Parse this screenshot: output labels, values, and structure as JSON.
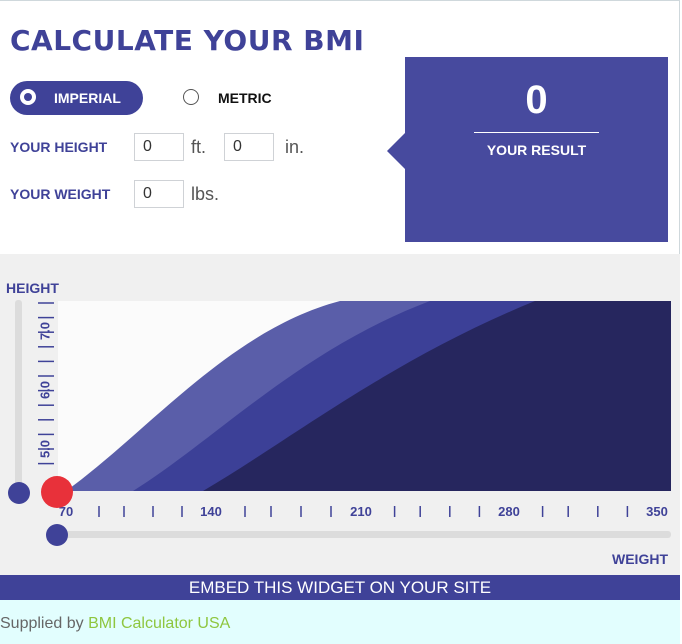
{
  "title": "CALCULATE YOUR BMI",
  "units": {
    "imperial_label": "IMPERIAL",
    "metric_label": "METRIC",
    "selected": "IMPERIAL"
  },
  "height": {
    "label": "YOUR HEIGHT",
    "ft_value": "0",
    "ft_unit": "ft.",
    "in_value": "0",
    "in_unit": "in."
  },
  "weight": {
    "label": "YOUR WEIGHT",
    "value": "0",
    "unit": "lbs."
  },
  "result": {
    "value": "0",
    "label": "YOUR RESULT"
  },
  "chart": {
    "height_axis_label": "HEIGHT",
    "weight_axis_label": "WEIGHT",
    "y_ticks": [
      "7.0",
      "6.0",
      "5.0"
    ],
    "x_ticks": [
      "70",
      "140",
      "210",
      "280",
      "350"
    ],
    "height_slider_value": 0,
    "weight_slider_value": 0,
    "colors": {
      "band_light": "#5a5ea9",
      "band_mid": "#3c4097",
      "band_dark": "#26265e",
      "marker": "#e8313a",
      "handle": "#3f4298"
    }
  },
  "embed_label": "EMBED THIS WIDGET ON YOUR SITE",
  "footer": {
    "prefix": "Supplied by ",
    "link_text": "BMI Calculator USA"
  }
}
